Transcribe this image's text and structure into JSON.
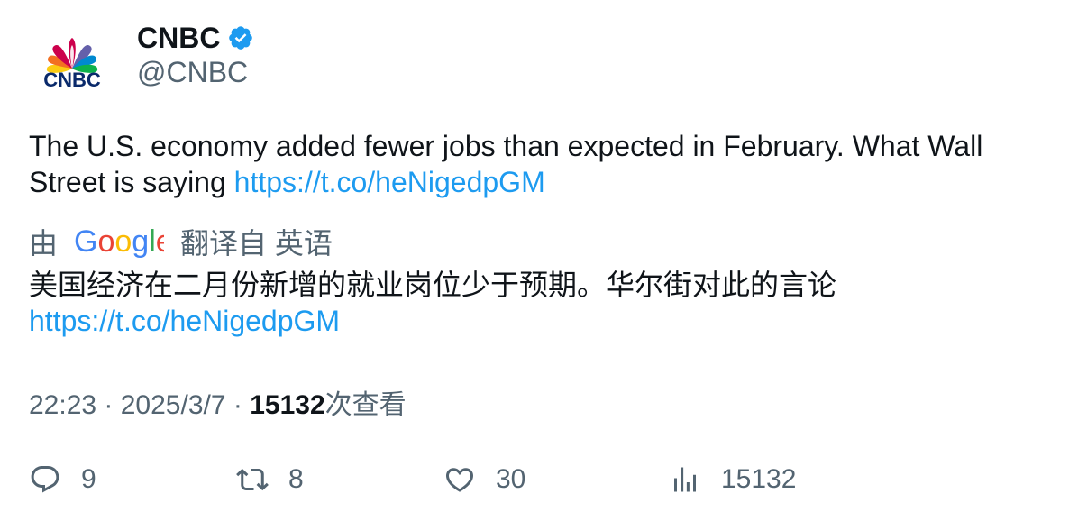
{
  "author": {
    "name": "CNBC",
    "handle": "@CNBC",
    "logo_text": "CNBC"
  },
  "tweet": {
    "text": "The U.S. economy added fewer jobs than expected in February. What Wall Street is saying ",
    "link": "https://t.co/heNigedpGM"
  },
  "translation": {
    "by_label": "由",
    "provider": "Google",
    "from_label": "翻译自 英语",
    "text": "美国经济在二月份新增的就业岗位少于预期。华尔街对此的言论",
    "link": "https://t.co/heNigedpGM"
  },
  "meta": {
    "time": "22:23",
    "sep1": " · ",
    "date": "2025/3/7",
    "sep2": " · ",
    "views": "15132",
    "views_label": "次查看"
  },
  "actions": {
    "replies": "9",
    "retweets": "8",
    "likes": "30",
    "views": "15132"
  },
  "colors": {
    "link": "#1d9bf0",
    "secondary_text": "#536471",
    "primary_text": "#0f1419",
    "verified": "#1d9bf0"
  },
  "icons": [
    "cnbc-peacock-logo",
    "verified-badge-icon",
    "google-logo",
    "reply-icon",
    "retweet-icon",
    "like-icon",
    "views-icon"
  ]
}
